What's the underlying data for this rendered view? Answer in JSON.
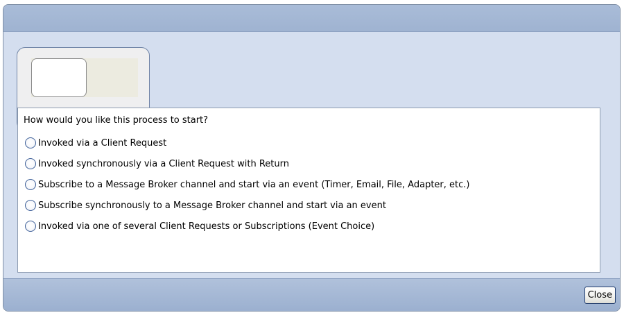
{
  "dialog": {
    "question": "How would you like this process to start?",
    "options": [
      "Invoked via a Client Request",
      "Invoked synchronously via a Client Request with Return",
      "Subscribe to a Message Broker channel and start via an event (Timer, Email, File, Adapter, etc.)",
      "Subscribe synchronously to a Message Broker channel and start via an event",
      "Invoked via one of several Client Requests or Subscriptions (Event Choice)"
    ],
    "selected_option": null,
    "close_label": "Close"
  }
}
